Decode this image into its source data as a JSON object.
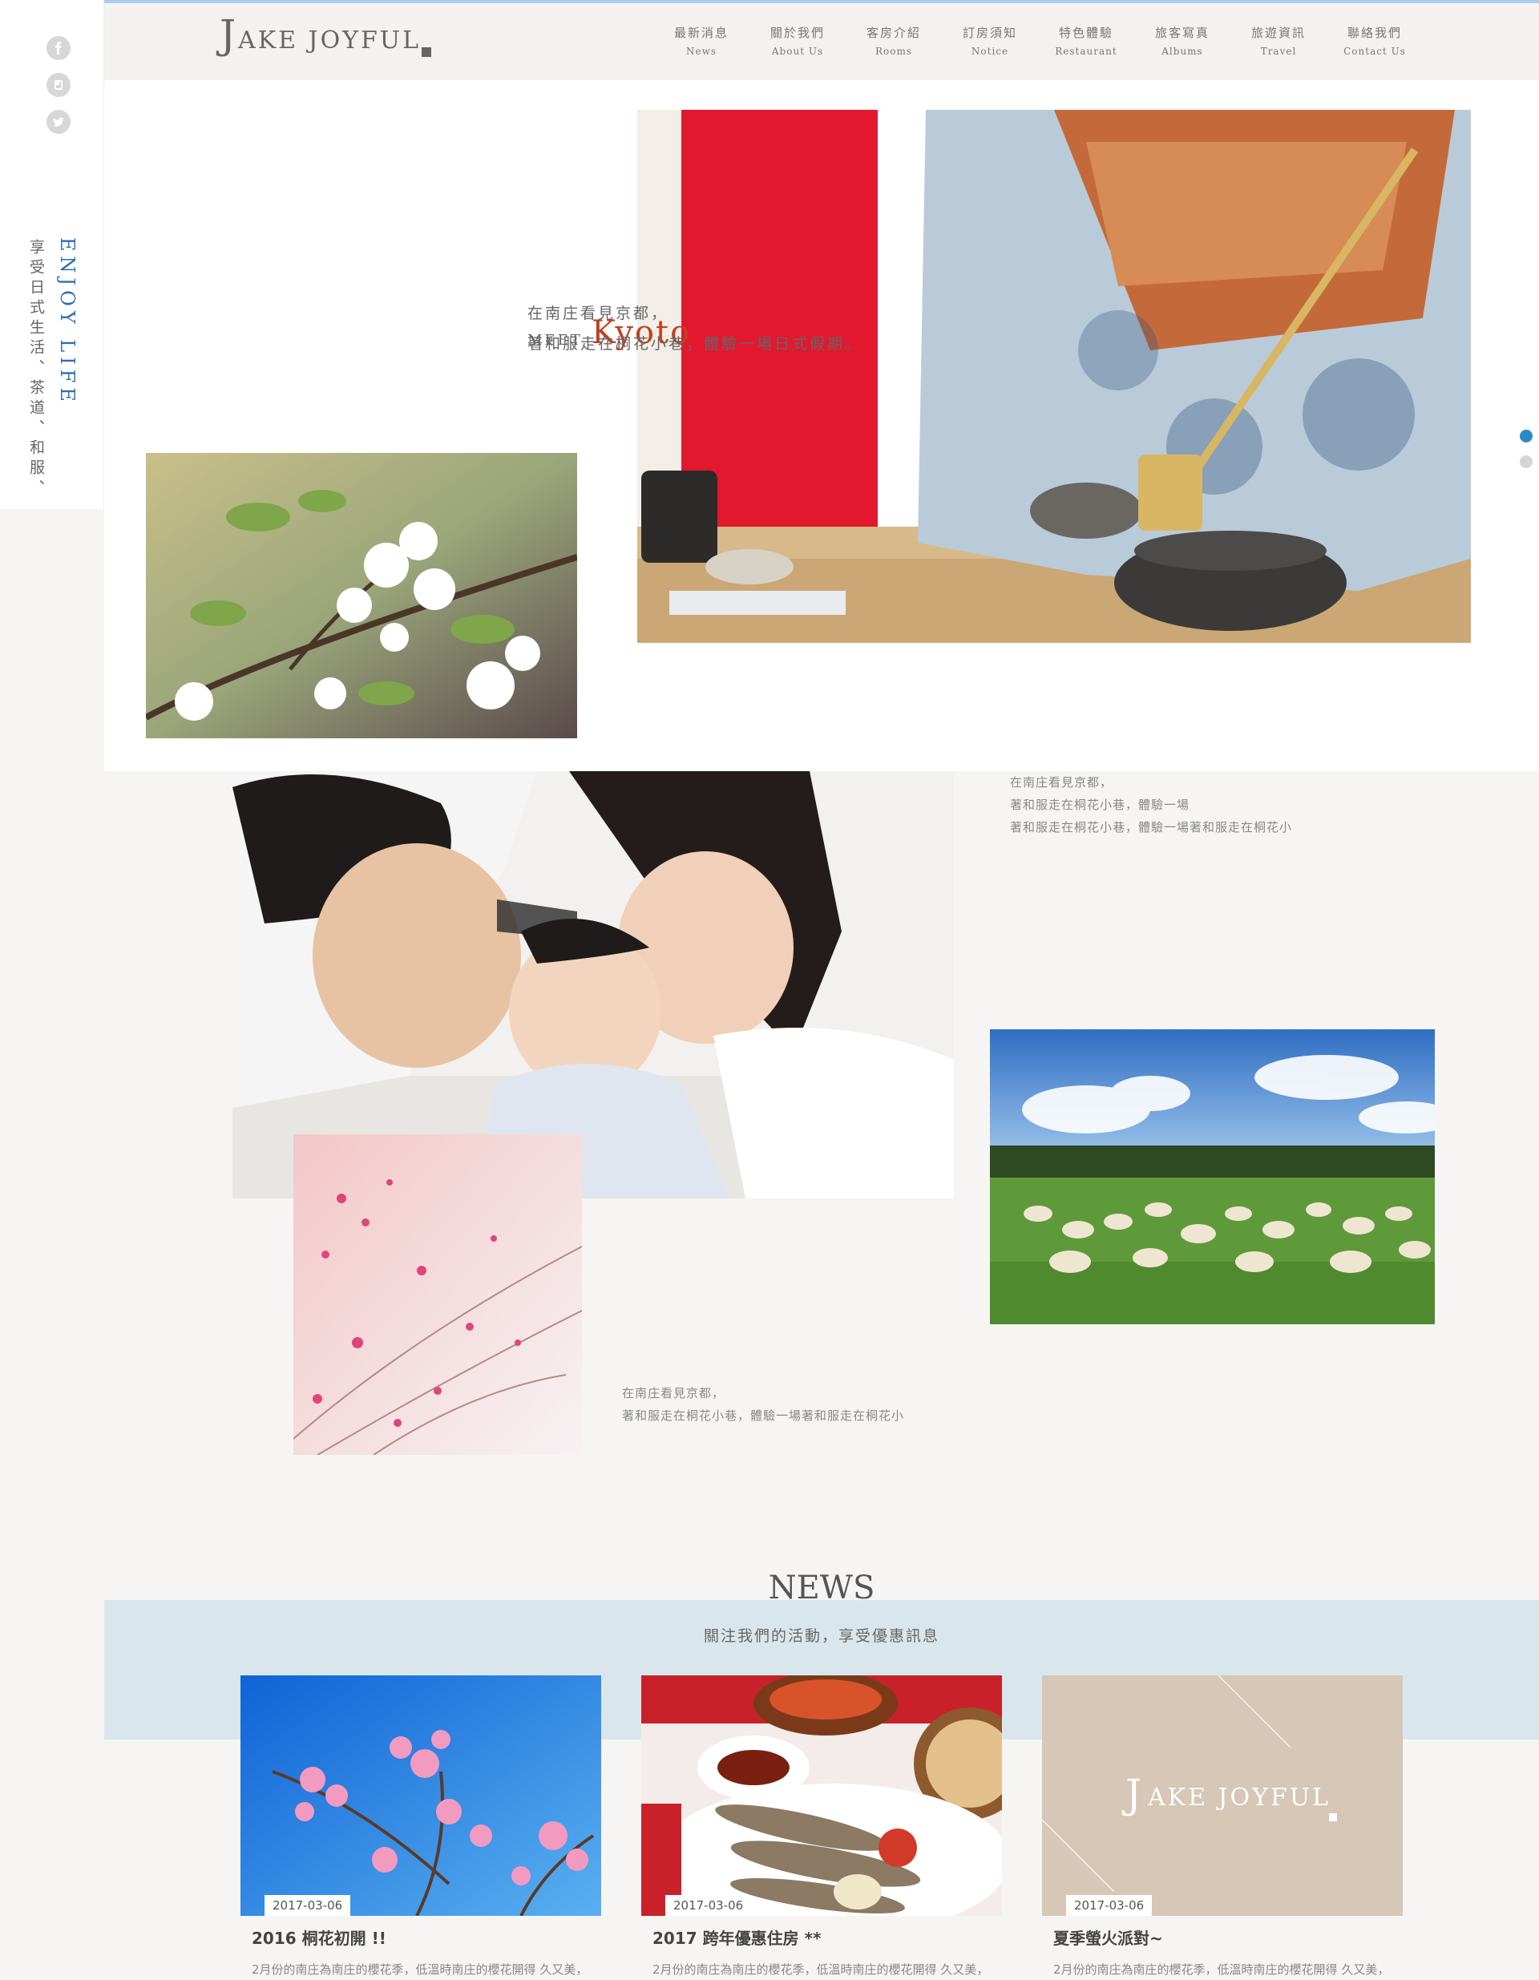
{
  "brand": {
    "logo_initial": "J",
    "logo_rest": "AKE  JOYFUL"
  },
  "nav": [
    {
      "zh": "最新消息",
      "en": "News"
    },
    {
      "zh": "關於我們",
      "en": "About Us"
    },
    {
      "zh": "客房介紹",
      "en": "Rooms"
    },
    {
      "zh": "訂房須知",
      "en": "Notice"
    },
    {
      "zh": "特色體驗",
      "en": "Restaurant"
    },
    {
      "zh": "旅客寫真",
      "en": "Albums"
    },
    {
      "zh": "旅遊資訊",
      "en": "Travel"
    },
    {
      "zh": "聯絡我們",
      "en": "Contact Us"
    }
  ],
  "social": [
    "facebook-icon",
    "plurk-icon",
    "twitter-icon"
  ],
  "side": {
    "title": "ENJOY LIFE",
    "subtitle": "享受日式生活、茶道、和服、"
  },
  "hero": {
    "meet": "MEET",
    "city": "Kyoto",
    "line1": "在南庄看見京都，",
    "line2": "著和服走在桐花小巷，體驗一場日式假期。"
  },
  "block1": {
    "line1": "在南庄看見京都，",
    "line2": "著和服走在桐花小巷，體驗一場",
    "line3": "著和服走在桐花小巷，體驗一場著和服走在桐花小"
  },
  "block2": {
    "line1": "在南庄看見京都，",
    "line2": "著和服走在桐花小巷，體驗一場著和服走在桐花小"
  },
  "news": {
    "title": "NEWS",
    "subtitle": "關注我們的活動，享受優惠訊息",
    "items": [
      {
        "date": "2017-03-06",
        "title": "2016 桐花初開 !!",
        "text": "2月份的南庄為南庄的櫻花季，低溫時南庄的櫻花開得 久又美，"
      },
      {
        "date": "2017-03-06",
        "title": "2017 跨年優惠住房 **",
        "text": "2月份的南庄為南庄的櫻花季，低溫時南庄的櫻花開得 久又美，"
      },
      {
        "date": "2017-03-06",
        "title": "夏季螢火派對~",
        "text": "2月份的南庄為南庄的櫻花季，低溫時南庄的櫻花開得 久又美，"
      }
    ]
  },
  "colors": {
    "accent_blue": "#2d6fb1",
    "kyoto_red": "#c0401f",
    "news_band": "#d9e7ec",
    "card_tan": "#d6c7b6"
  }
}
